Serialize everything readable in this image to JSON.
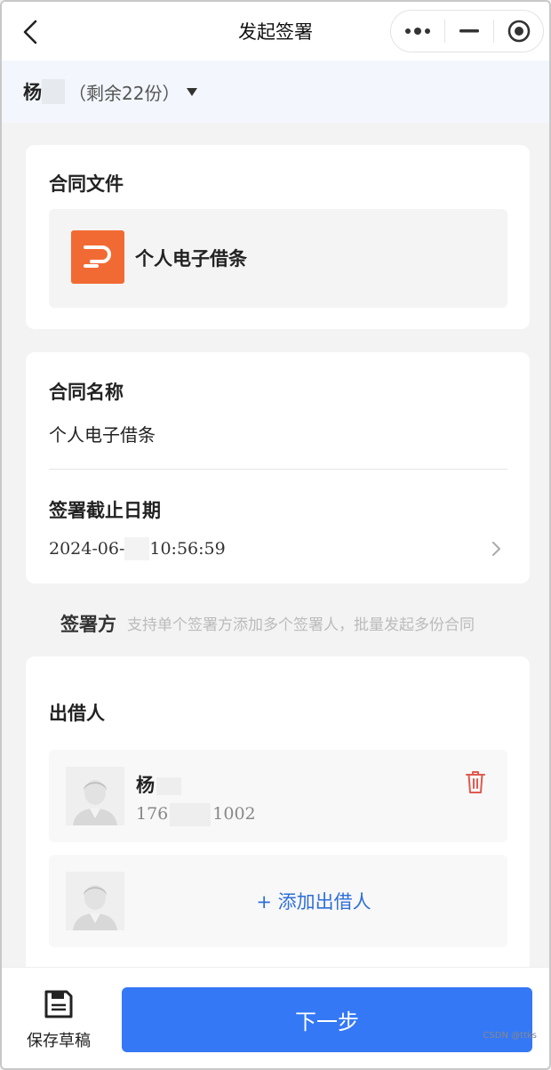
{
  "navbar": {
    "title": "发起签署",
    "back_icon": "chevron-left-icon",
    "capsule": {
      "more_icon": "more-dots-icon",
      "minimize_icon": "minimize-icon",
      "close_icon": "target-close-icon"
    }
  },
  "account": {
    "name_prefix": "杨",
    "remaining": "（剩余22份）",
    "dropdown_icon": "caret-down-icon"
  },
  "contract_file": {
    "section_title": "合同文件",
    "file_name": "个人电子借条",
    "file_icon": "file-p-icon",
    "file_icon_color": "#f26a33"
  },
  "contract_info": {
    "name_label": "合同名称",
    "name_value": "个人电子借条",
    "deadline_label": "签署截止日期",
    "deadline_date_prefix": "2024-06-",
    "deadline_time": "10:56:59",
    "deadline_chevron_icon": "chevron-right-icon"
  },
  "signers": {
    "title": "签署方",
    "hint": "支持单个签署方添加多个签署人，批量发起多份合同"
  },
  "lender": {
    "section_title": "出借人",
    "person": {
      "name_prefix": "杨",
      "phone_prefix": "176",
      "phone_suffix": "1002",
      "avatar_icon": "user-avatar-icon",
      "delete_icon": "trash-icon"
    },
    "add_label": "+ 添加出借人"
  },
  "bottom": {
    "save_draft_label": "保存草稿",
    "save_icon": "floppy-disk-icon",
    "next_label": "下一步",
    "accent": "#3478f6"
  },
  "watermark": "CSDN @ttks"
}
